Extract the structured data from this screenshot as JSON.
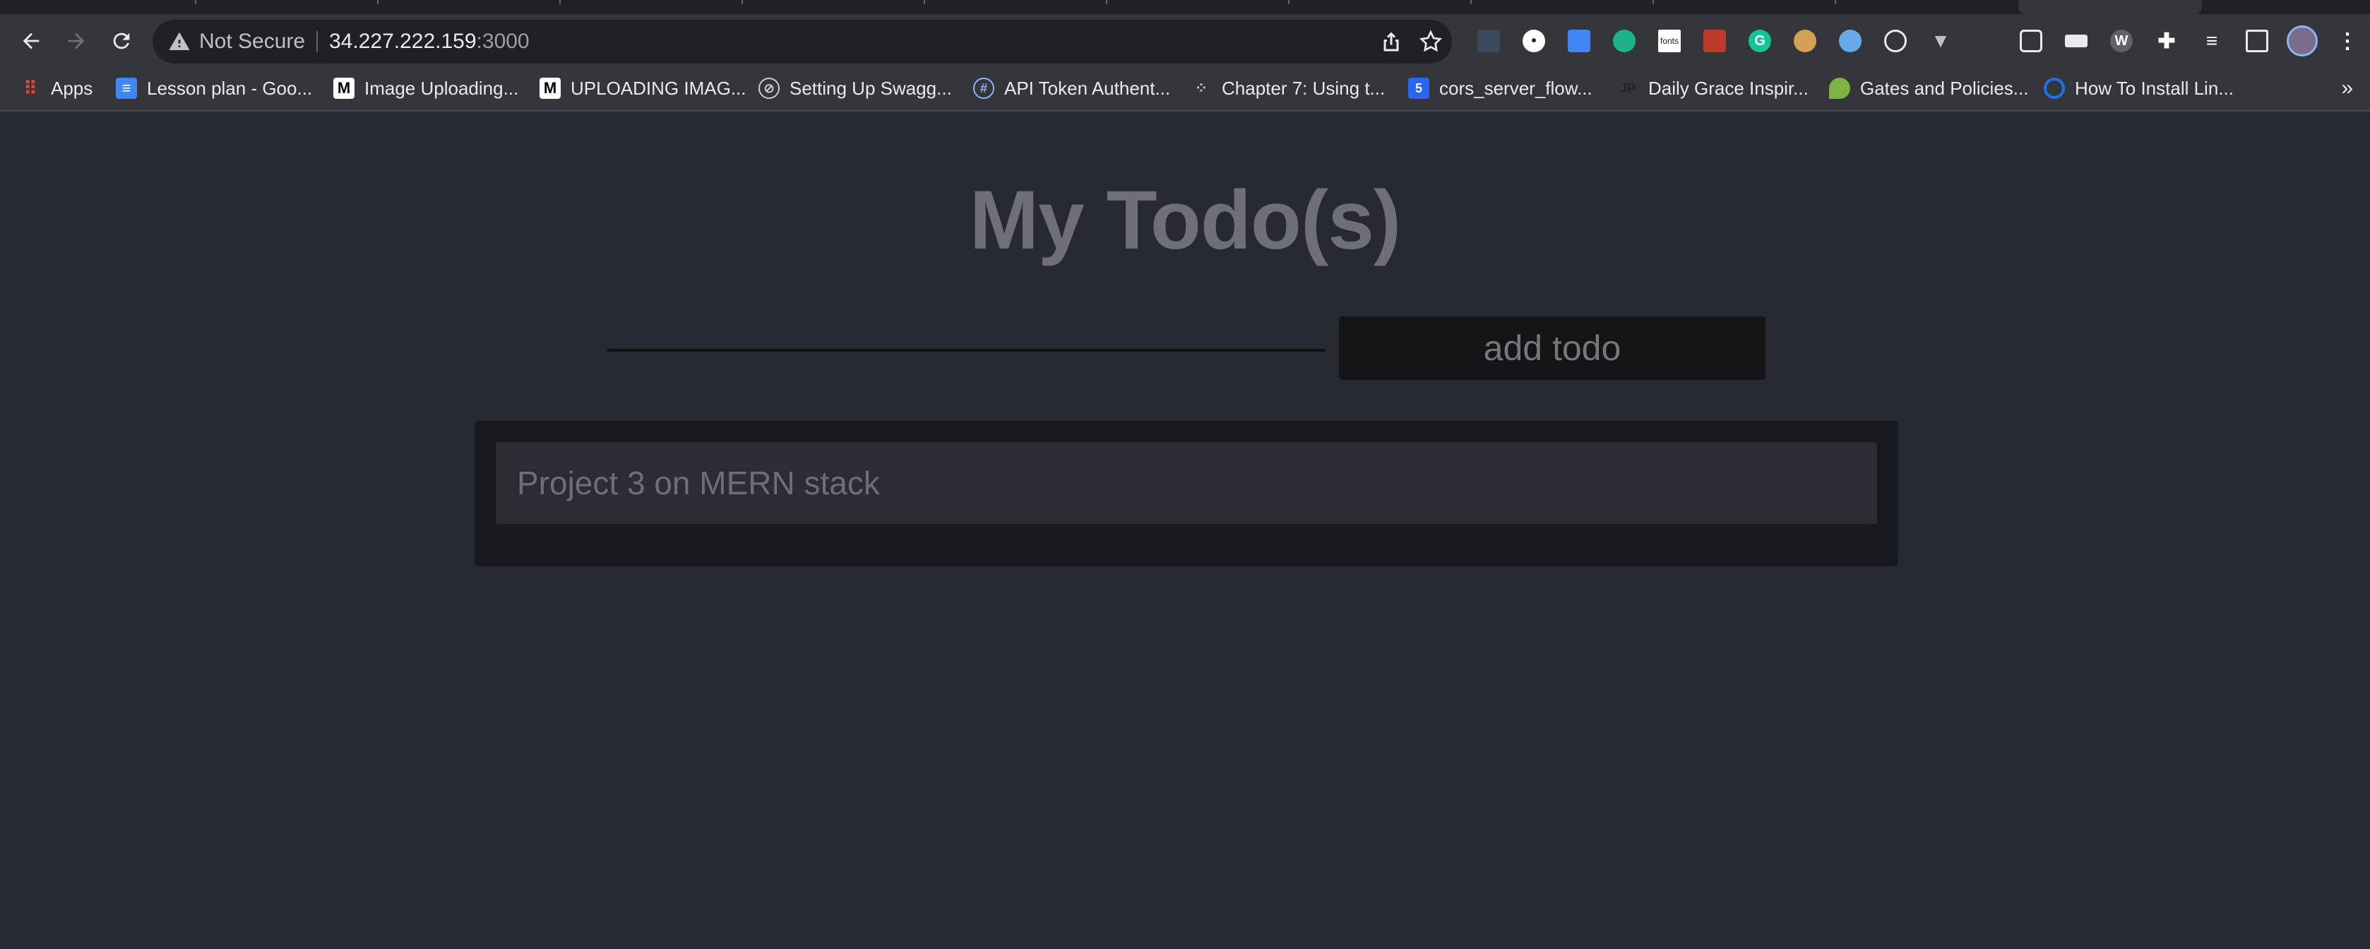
{
  "browser": {
    "security_label": "Not Secure",
    "url_host": "34.227.222.159",
    "url_port": ":3000",
    "bookmarks": [
      {
        "label": "Apps",
        "icon": "apps-grid-icon",
        "color": "#ea4335"
      },
      {
        "label": "Lesson plan - Goo...",
        "icon": "google-docs-icon",
        "color": "#4285f4"
      },
      {
        "label": "Image Uploading...",
        "icon": "medium-icon",
        "color": "#ffffff"
      },
      {
        "label": "UPLOADING IMAG...",
        "icon": "medium-icon",
        "color": "#ffffff"
      },
      {
        "label": "Setting Up Swagg...",
        "icon": "swagger-icon",
        "color": "#cccccc"
      },
      {
        "label": "API Token Authent...",
        "icon": "hashnode-icon",
        "color": "#8ab4f8"
      },
      {
        "label": "Chapter 7: Using t...",
        "icon": "dots-icon",
        "color": "#bbbbbb"
      },
      {
        "label": "cors_server_flow...",
        "icon": "css3-icon",
        "color": "#2965f1"
      },
      {
        "label": "Daily Grace Inspir...",
        "icon": "jp-icon",
        "color": "#000000"
      },
      {
        "label": "Gates and Policies...",
        "icon": "leaf-icon",
        "color": "#7cb342"
      },
      {
        "label": "How To Install Lin...",
        "icon": "digitalocean-icon",
        "color": "#1a73e8"
      }
    ],
    "bookmarks_overflow": "»",
    "ext_fonts_label": "fonts"
  },
  "app": {
    "title": "My Todo(s)",
    "input_value": "",
    "add_button_label": "add todo",
    "todos": [
      "Project 3 on MERN stack"
    ]
  },
  "colors": {
    "page_bg": "#282a33",
    "title": "#6f7077",
    "card_bg": "#18191d",
    "item_bg": "#2b2c34"
  }
}
